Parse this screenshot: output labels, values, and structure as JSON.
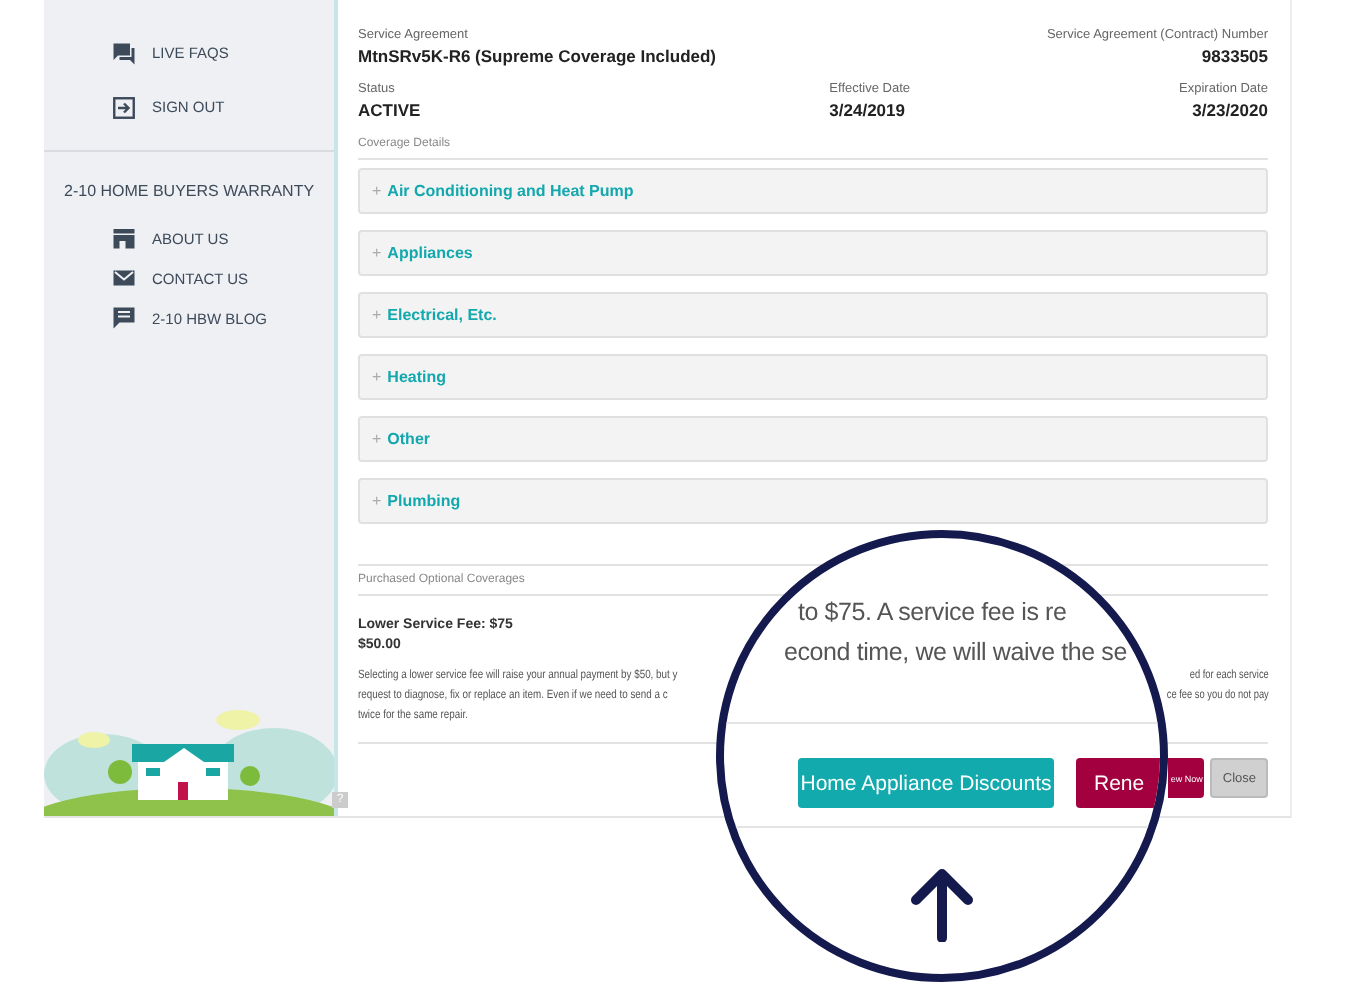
{
  "sidebar": {
    "top_items": [
      {
        "label": "LIVE FAQS",
        "kind": "chat"
      },
      {
        "label": "SIGN OUT",
        "kind": "exit"
      }
    ],
    "section_title": "2-10 HOME BUYERS WARRANTY",
    "section_items": [
      {
        "label": "ABOUT US",
        "kind": "store"
      },
      {
        "label": "CONTACT US",
        "kind": "mail"
      },
      {
        "label": "2-10 HBW BLOG",
        "kind": "comment"
      }
    ]
  },
  "agreement": {
    "label": "Service Agreement",
    "value": "MtnSRv5K-R6 (Supreme Coverage Included)",
    "number_label": "Service Agreement (Contract) Number",
    "number": "9833505"
  },
  "dates": [
    {
      "label": "Status",
      "value": "ACTIVE"
    },
    {
      "label": "Effective Date",
      "value": "3/24/2019"
    },
    {
      "label": "Expiration Date",
      "value": "3/23/2020"
    }
  ],
  "coverage_title": "Coverage Details",
  "coverages": [
    {
      "toggle": "+",
      "label": "Air Conditioning and Heat Pump"
    },
    {
      "toggle": "+",
      "label": "Appliances"
    },
    {
      "toggle": "+",
      "label": "Electrical, Etc."
    },
    {
      "toggle": "+",
      "label": "Heating"
    },
    {
      "toggle": "+",
      "label": "Other"
    },
    {
      "toggle": "+",
      "label": "Plumbing"
    }
  ],
  "optional": {
    "title": "Purchased Optional Coverages",
    "fee_name": "Lower Service Fee: $75",
    "fee_price": "$50.00",
    "description_left": [
      "Selecting a lower service fee will raise your annual payment by $50, but y",
      "request to diagnose, fix or replace an item. Even if we need to send a c",
      "twice for the same repair."
    ],
    "description_right": [
      "ed for each service",
      "ce fee so you do not pay"
    ]
  },
  "help": "?",
  "buttons": {
    "renew": "ew Now",
    "close": "Close"
  },
  "magnifier": {
    "lines": [
      "to $75. A service fee is re",
      "econd time, we will waive the se"
    ],
    "discount_button": "Home Appliance Discounts",
    "renew_fragment": "Rene"
  }
}
